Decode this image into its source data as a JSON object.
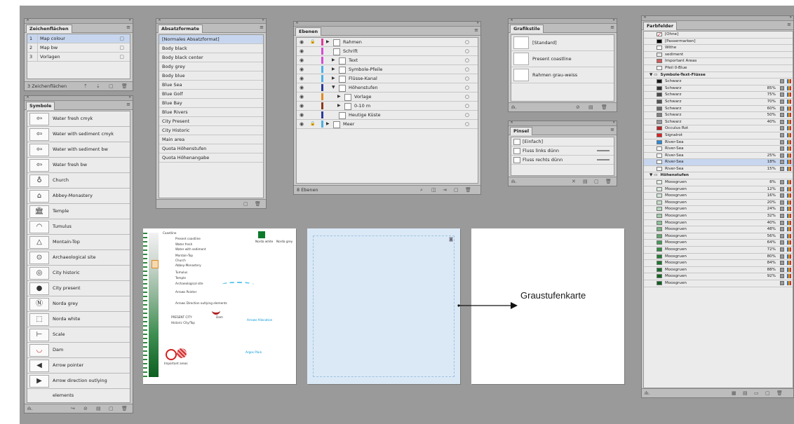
{
  "zeichenflaechen": {
    "title": "Zeichenflächen",
    "items": [
      {
        "num": "1",
        "name": "Map colour"
      },
      {
        "num": "2",
        "name": "Map bw"
      },
      {
        "num": "3",
        "name": "Vorlagen"
      }
    ],
    "footer": "3 Zeichenflächen"
  },
  "symbole": {
    "title": "Symbole",
    "items": [
      {
        "label": "Water fresh cmyk",
        "icon": "water-arrow-icon"
      },
      {
        "label": "Water with sediment cmyk",
        "icon": "water-arrow-icon"
      },
      {
        "label": "Water with sediment bw",
        "icon": "water-arrow-icon"
      },
      {
        "label": "Water fresh bw",
        "icon": "water-arrow-icon"
      },
      {
        "label": "Church",
        "icon": "church-icon"
      },
      {
        "label": "Abbey-Monastery",
        "icon": "abbey-icon"
      },
      {
        "label": "Temple",
        "icon": "temple-icon"
      },
      {
        "label": "Tumulus",
        "icon": "tumulus-icon"
      },
      {
        "label": "Montain-Top",
        "icon": "triangle-icon"
      },
      {
        "label": "Archaeological site",
        "icon": "archaeological-icon"
      },
      {
        "label": "City historic",
        "icon": "city-historic-icon"
      },
      {
        "label": "City present",
        "icon": "city-present-icon"
      },
      {
        "label": "Norda grey",
        "icon": "north-icon"
      },
      {
        "label": "Norda white",
        "icon": "north-white-icon"
      },
      {
        "label": "Scale",
        "icon": "scale-icon"
      },
      {
        "label": "Dam",
        "icon": "dam-icon"
      },
      {
        "label": "Arrow pointer",
        "icon": "arrow-pointer-icon"
      },
      {
        "label": "Arrow direction outlying elements",
        "icon": "arrow-direction-icon"
      }
    ]
  },
  "absatzformate": {
    "title": "Absatzformate",
    "items": [
      "[Normales Absatzformat]",
      "Body black",
      "Body black center",
      "Body grey",
      "Body blue",
      "Blue Sea",
      "Blue Golf",
      "Blue Bay",
      "Blue Rivers",
      "City Present",
      "City Historic",
      "Main area",
      "Quota Höhenstufen",
      "Quota Höhenangabe"
    ]
  },
  "ebenen": {
    "title": "Ebenen",
    "layers": [
      {
        "name": "Rahmen",
        "color": "#e03ca0"
      },
      {
        "name": "Schrift",
        "color": "#d34cd8"
      },
      {
        "name": "Text",
        "color": "#d34cd8"
      },
      {
        "name": "Symbole-Pfeile",
        "color": "#4ab0e6"
      },
      {
        "name": "Flüsse-Kanal",
        "color": "#4ab0e6"
      },
      {
        "name": "Höhenstufen",
        "color": "#2a3a9a"
      },
      {
        "name": "Vorlage",
        "color": "#e08a20"
      },
      {
        "name": "0-10 m",
        "color": "#8a3a1a"
      },
      {
        "name": "Heutige Küste",
        "color": "#2a3a9a"
      },
      {
        "name": "Meer",
        "color": "#4ab0e6"
      }
    ],
    "footer": "8 Ebenen"
  },
  "grafikstile": {
    "title": "Grafikstile",
    "items": [
      "[Standard]",
      "Present coastline",
      "Rahmen grau-weiss"
    ]
  },
  "pinsel": {
    "title": "Pinsel",
    "items": [
      "[Einfach]",
      "Fluss links dünn",
      "Fluss rechts dünn"
    ]
  },
  "farbfelder": {
    "title": "Farbfelder",
    "top": [
      {
        "name": "[Ohne]",
        "chip": "none"
      },
      {
        "name": "[Passermarken]",
        "chip": "#000000"
      },
      {
        "name": "Withe",
        "chip": "#ffffff"
      },
      {
        "name": "sediment",
        "chip": "#e8e8e8"
      },
      {
        "name": "Important Areas",
        "chip": "#d45a5a"
      },
      {
        "name": "Pfeil 0-Blue",
        "chip": "#ffffff"
      }
    ],
    "group1": "Symbole-Text-Flüsse",
    "group1_items": [
      {
        "name": "Schwarz",
        "pct": "",
        "chip": "#1a1a1a"
      },
      {
        "name": "Schwarz",
        "pct": "85%",
        "chip": "#333333"
      },
      {
        "name": "Schwarz",
        "pct": "75%",
        "chip": "#4a4a4a"
      },
      {
        "name": "Schwarz",
        "pct": "70%",
        "chip": "#555555"
      },
      {
        "name": "Schwarz",
        "pct": "60%",
        "chip": "#6a6a6a"
      },
      {
        "name": "Schwarz",
        "pct": "50%",
        "chip": "#808080"
      },
      {
        "name": "Schwarz",
        "pct": "40%",
        "chip": "#999999"
      },
      {
        "name": "Occulus Rot",
        "pct": "",
        "chip": "#c02020"
      },
      {
        "name": "Signalrot",
        "pct": "",
        "chip": "#e02020"
      },
      {
        "name": "River-Sea",
        "pct": "",
        "chip": "#2a8ad8"
      },
      {
        "name": "River-Sea",
        "pct": "",
        "chip": "#ffffff"
      },
      {
        "name": "River-Sea",
        "pct": "25%",
        "chip": "#ffffff"
      },
      {
        "name": "River-Sea",
        "pct": "18%",
        "chip": "#ffffff",
        "sel": true
      },
      {
        "name": "River-Sea",
        "pct": "15%",
        "chip": "#ffffff"
      }
    ],
    "group2": "Höhenstufen",
    "group2_items": [
      {
        "name": "Moosgruen",
        "pct": "8%",
        "chip": "#e8f2ea"
      },
      {
        "name": "Moosgruen",
        "pct": "12%",
        "chip": "#dcecdf"
      },
      {
        "name": "Moosgruen",
        "pct": "16%",
        "chip": "#d1e6d5"
      },
      {
        "name": "Moosgruen",
        "pct": "20%",
        "chip": "#c5e0ca"
      },
      {
        "name": "Moosgruen",
        "pct": "24%",
        "chip": "#bad9c0"
      },
      {
        "name": "Moosgruen",
        "pct": "32%",
        "chip": "#a3ccab"
      },
      {
        "name": "Moosgruen",
        "pct": "40%",
        "chip": "#8cc096"
      },
      {
        "name": "Moosgruen",
        "pct": "48%",
        "chip": "#75b381"
      },
      {
        "name": "Moosgruen",
        "pct": "56%",
        "chip": "#5ea76c"
      },
      {
        "name": "Moosgruen",
        "pct": "64%",
        "chip": "#479a57"
      },
      {
        "name": "Moosgruen",
        "pct": "72%",
        "chip": "#318d43"
      },
      {
        "name": "Moosgruen",
        "pct": "80%",
        "chip": "#1f8033"
      },
      {
        "name": "Moosgruen",
        "pct": "84%",
        "chip": "#1a782d"
      },
      {
        "name": "Moosgruen",
        "pct": "88%",
        "chip": "#157028"
      },
      {
        "name": "Moosgruen",
        "pct": "92%",
        "chip": "#106822"
      },
      {
        "name": "Moosgruen",
        "pct": "",
        "chip": "#0c5f1d"
      }
    ]
  },
  "artboard1": {
    "legend_title": "Coastline",
    "items": [
      "Present coastline",
      "Water fresh",
      "Water with sediment",
      "Montain-Top",
      "Church",
      "Abbey-Monastery",
      "Tumulus",
      "Temple",
      "Archaeological site",
      "Arrows Pointer",
      "Arrows Direction outlying elements",
      "PRESENT CITY",
      "Historic City/Top",
      "Dam",
      "Important areas",
      "Argos Plain",
      "Norda white",
      "Norda grey",
      "Arrows Allocation"
    ]
  },
  "annotation": {
    "label": "Graustufenkarte"
  }
}
